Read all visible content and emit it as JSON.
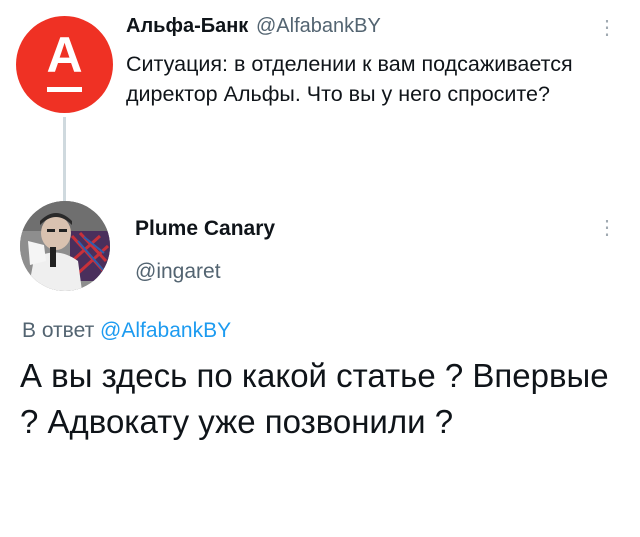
{
  "tweet": {
    "author_name": "Альфа-Банк",
    "author_handle": "@AlfabankBY",
    "avatar_letter": "А",
    "text": "Ситуация: в отделении к вам подсаживается директор Альфы. Что вы у него спросите?",
    "more_icon": "vertical-dots-icon"
  },
  "reply": {
    "author_name": "Plume Canary",
    "author_handle": "@ingaret",
    "reply_prefix": "В ответ ",
    "reply_handle": "@AlfabankBY",
    "text": "А вы здесь по какой статье ? Впервые ? Адвокату уже позвонили ?",
    "more_icon": "vertical-dots-icon"
  },
  "colors": {
    "brand_red": "#ef3124",
    "link_blue": "#1d9bf0",
    "secondary_text": "#536471",
    "thread_line": "#cfd9de"
  }
}
